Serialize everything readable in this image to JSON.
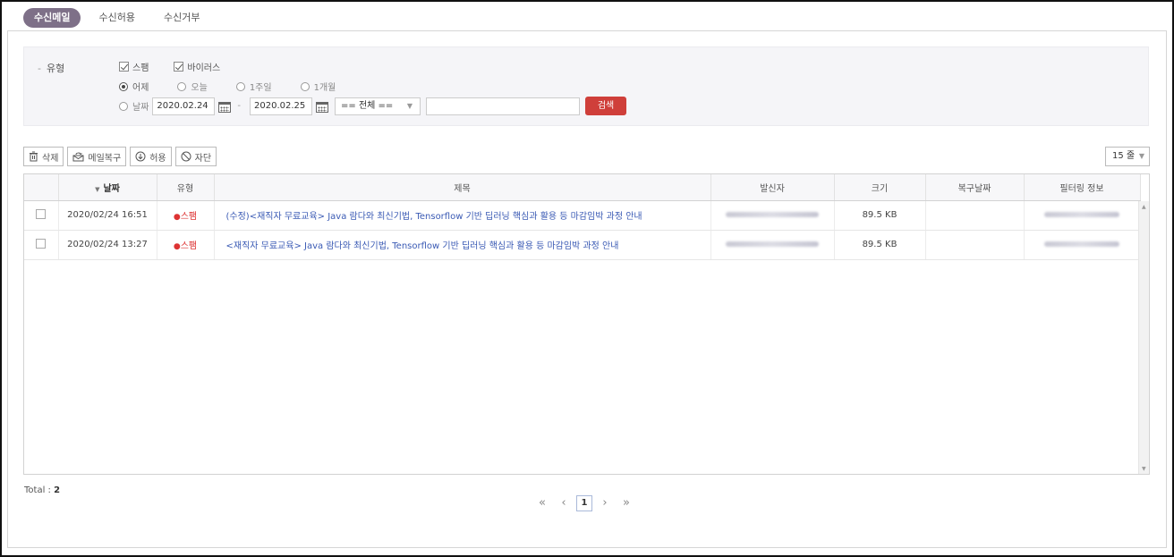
{
  "tabs": [
    {
      "label": "수신메일",
      "active": true
    },
    {
      "label": "수신허용",
      "active": false
    },
    {
      "label": "수신거부",
      "active": false
    }
  ],
  "search": {
    "type_label": "유형",
    "checkboxes": [
      {
        "label": "스팸",
        "checked": true
      },
      {
        "label": "바이러스",
        "checked": true
      }
    ],
    "periods": [
      {
        "label": "어제",
        "selected": true
      },
      {
        "label": "오늘",
        "selected": false
      },
      {
        "label": "1주일",
        "selected": false
      },
      {
        "label": "1개월",
        "selected": false
      }
    ],
    "date_radio_label": "날짜",
    "date_from": "2020.02.24",
    "date_to": "2020.02.25",
    "field_select": "== 전체 ==",
    "keyword": "",
    "search_button": "검색"
  },
  "toolbar": {
    "delete": "삭제",
    "restore": "메일복구",
    "allow": "허용",
    "block": "자단",
    "per_page": "15 줄"
  },
  "table": {
    "headers": {
      "date": "날짜",
      "type": "유형",
      "subject": "제목",
      "sender": "발신자",
      "size": "크기",
      "restore_date": "복구날짜",
      "filter_info": "필터링 정보"
    },
    "rows": [
      {
        "date": "2020/02/24 16:51",
        "type": "스팸",
        "subject": "(수정)<재직자 무료교육> Java 람다와 최신기법, Tensorflow 기반 딥러닝 핵심과 활용 등 마감임박 과정 안내",
        "size": "89.5 KB",
        "restore_date": ""
      },
      {
        "date": "2020/02/24 13:27",
        "type": "스팸",
        "subject": "<재직자 무료교육> Java 람다와 최신기법, Tensorflow 기반 딥러닝 핵심과 활용 등 마감임박 과정 안내",
        "size": "89.5 KB",
        "restore_date": ""
      }
    ]
  },
  "footer": {
    "total_label": "Total :",
    "total_count": "2",
    "current_page": "1"
  },
  "colors": {
    "active_tab": "#7e7088",
    "search_button": "#cf3f3a",
    "subject_link": "#3a5ab4",
    "spam_type": "#dd3333"
  }
}
